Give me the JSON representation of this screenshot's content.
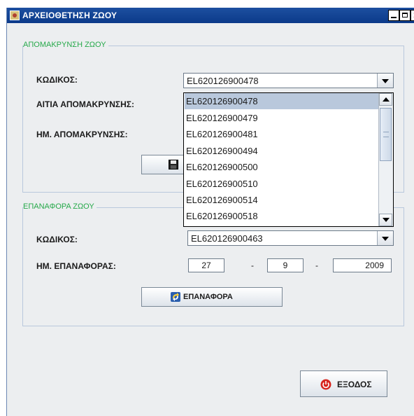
{
  "window": {
    "title": "ΑΡΧΕΙΟΘΕΤΗΣΗ ΖΩΟΥ"
  },
  "removal": {
    "legend": "ΑΠΟΜΑΚΡΥΝΣΗ ΖΩΟΥ",
    "code_label": "ΚΩΔΙΚΟΣ:",
    "code_value": "EL620126900478",
    "reason_label": "ΑΙΤΙΑ ΑΠΟΜΑΚΡΥΝΣΗΣ:",
    "date_label": "ΗΜ. ΑΠΟΜΑΚΡΥΝΣΗΣ:",
    "dropdown_options": [
      "EL620126900478",
      "EL620126900479",
      "EL620126900481",
      "EL620126900494",
      "EL620126900500",
      "EL620126900510",
      "EL620126900514",
      "EL620126900518"
    ],
    "selected_option": "EL620126900478"
  },
  "restore": {
    "legend": "ΕΠΑΝΑΦΟΡΑ ΖΩΟΥ",
    "code_label": "ΚΩΔΙΚΟΣ:",
    "code_value": "EL620126900463",
    "date_label": "ΗΜ. ΕΠΑΝΑΦΟΡΑΣ:",
    "date_day": "27",
    "date_month": "9",
    "date_year": "2009",
    "date_separator": "-",
    "button_label": "ΕΠΑΝΑΦΟΡΑ"
  },
  "exit_button": {
    "label": "ΕΞΟΔΟΣ"
  },
  "icons": {
    "app": "java-cup-icon",
    "save": "floppy-disk-icon",
    "restore": "restore-arrows-icon",
    "exit": "exit-power-icon"
  },
  "colors": {
    "titlebar": "#0b3a8a",
    "legend": "#26a94a",
    "selection": "#b9c8dc"
  }
}
